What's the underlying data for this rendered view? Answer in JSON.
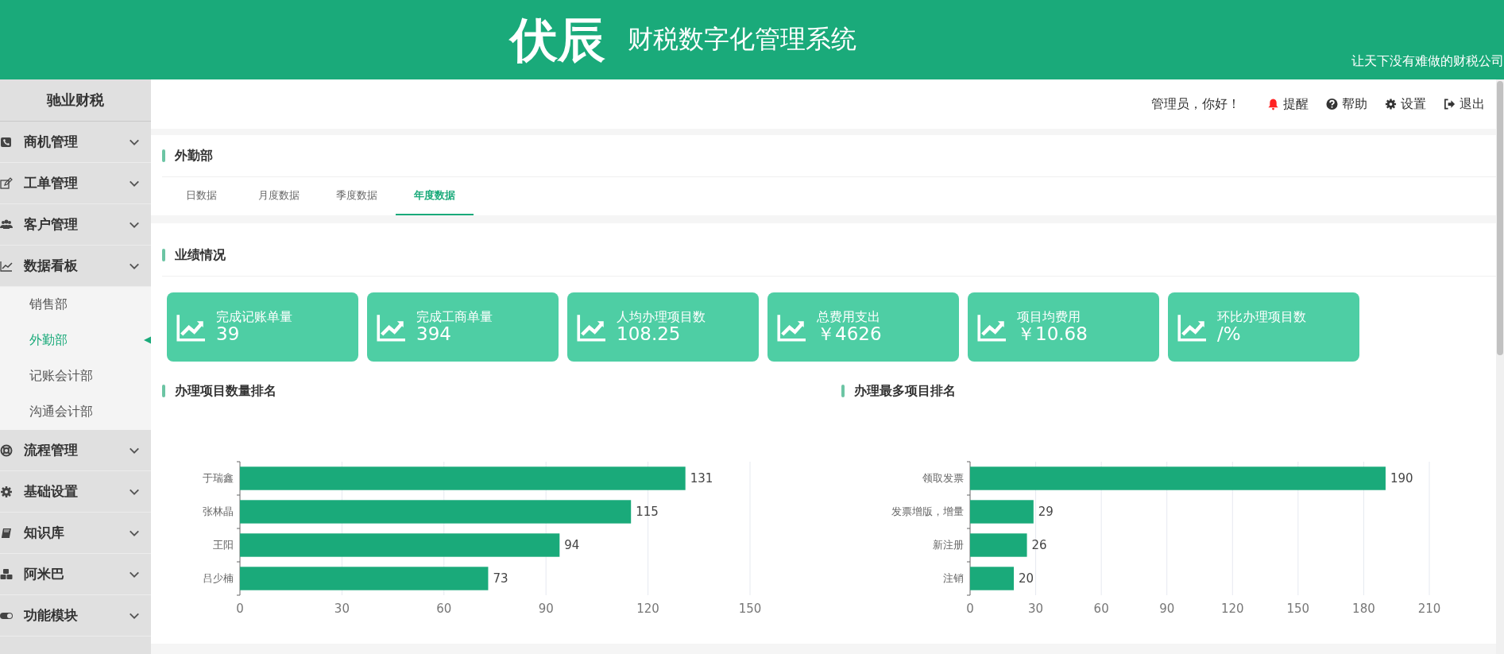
{
  "header": {
    "logo": "伏辰",
    "title": "财税数字化管理系统",
    "tagline": "让天下没有难做的财税公司"
  },
  "sidebar": {
    "title": "驰业财税",
    "items": [
      {
        "label": "商机管理"
      },
      {
        "label": "工单管理"
      },
      {
        "label": "客户管理"
      },
      {
        "label": "数据看板",
        "children": [
          {
            "label": "销售部",
            "selected": false
          },
          {
            "label": "外勤部",
            "selected": true
          },
          {
            "label": "记账会计部",
            "selected": false
          },
          {
            "label": "沟通会计部",
            "selected": false
          }
        ]
      },
      {
        "label": "流程管理"
      },
      {
        "label": "基础设置"
      },
      {
        "label": "知识库"
      },
      {
        "label": "阿米巴"
      },
      {
        "label": "功能模块"
      }
    ]
  },
  "topbar": {
    "greeting": "管理员，你好！",
    "links": [
      "提醒",
      "帮助",
      "设置",
      "退出"
    ]
  },
  "department": {
    "title": "外勤部",
    "tabs": [
      {
        "label": "日数据",
        "selected": false
      },
      {
        "label": "月度数据",
        "selected": false
      },
      {
        "label": "季度数据",
        "selected": false
      },
      {
        "label": "年度数据",
        "selected": true
      }
    ]
  },
  "performance": {
    "title": "业绩情况",
    "cards": [
      {
        "label": "完成记账单量",
        "value": "39"
      },
      {
        "label": "完成工商单量",
        "value": "394"
      },
      {
        "label": "人均办理项目数",
        "value": "108.25"
      },
      {
        "label": "总费用支出",
        "value": "￥4626"
      },
      {
        "label": "项目均费用",
        "value": "￥10.68"
      },
      {
        "label": "环比办理项目数",
        "value": "/%"
      }
    ]
  },
  "charts": [
    {
      "title": "办理项目数量排名",
      "chart_data": {
        "type": "bar",
        "orientation": "horizontal",
        "categories": [
          "于瑞鑫",
          "张林晶",
          "王阳",
          "吕少楠"
        ],
        "values": [
          131,
          115,
          94,
          73
        ],
        "xlim": [
          0,
          150
        ],
        "xticks": [
          0,
          30,
          60,
          90,
          120,
          150
        ],
        "grid": true,
        "data_labels": true
      }
    },
    {
      "title": "办理最多项目排名",
      "chart_data": {
        "type": "bar",
        "orientation": "horizontal",
        "categories": [
          "领取发票",
          "发票增版，增量",
          "新注册",
          "注销"
        ],
        "values": [
          190,
          29,
          26,
          20
        ],
        "xlim": [
          0,
          210
        ],
        "xticks": [
          0,
          30,
          60,
          90,
          120,
          150,
          180,
          210
        ],
        "grid": true,
        "data_labels": true
      }
    }
  ]
}
